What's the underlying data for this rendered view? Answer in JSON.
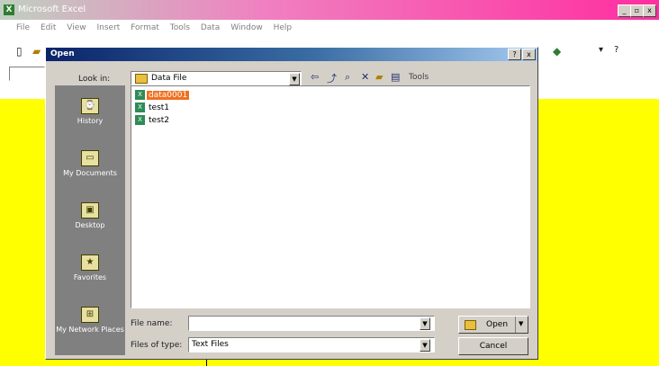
{
  "app": {
    "title": "Microsoft Excel",
    "logo_glyph": "X",
    "caption_buttons": [
      "_",
      "▫",
      "x"
    ]
  },
  "menubar": {
    "items": [
      "File",
      "Edit",
      "View",
      "Insert",
      "Format",
      "Tools",
      "Data",
      "Window",
      "Help"
    ]
  },
  "toolbar": {
    "zoom_glyph": "▾",
    "help_glyph": "?"
  },
  "sheet": {
    "background": "#ffff00"
  },
  "dialog": {
    "title": "Open",
    "help_button": "?",
    "close_button": "x",
    "look_in_label": "Look in:",
    "look_in_value": "Data File",
    "tools_label": "Tools",
    "places": [
      {
        "label": "History",
        "icon": "history-icon",
        "glyph": "⌚"
      },
      {
        "label": "My Documents",
        "icon": "folder-icon",
        "glyph": "▭"
      },
      {
        "label": "Desktop",
        "icon": "desktop-icon",
        "glyph": "▣"
      },
      {
        "label": "Favorites",
        "icon": "star-icon",
        "glyph": "★"
      },
      {
        "label": "My Network Places",
        "icon": "network-icon",
        "glyph": "⊞"
      }
    ],
    "files": [
      {
        "name": "data0001",
        "selected": true
      },
      {
        "name": "test1",
        "selected": false
      },
      {
        "name": "test2",
        "selected": false
      }
    ],
    "file_name_label": "File name:",
    "file_name_value": "",
    "file_type_label": "Files of type:",
    "file_type_value": "Text Files",
    "open_button": "Open",
    "cancel_button": "Cancel"
  }
}
